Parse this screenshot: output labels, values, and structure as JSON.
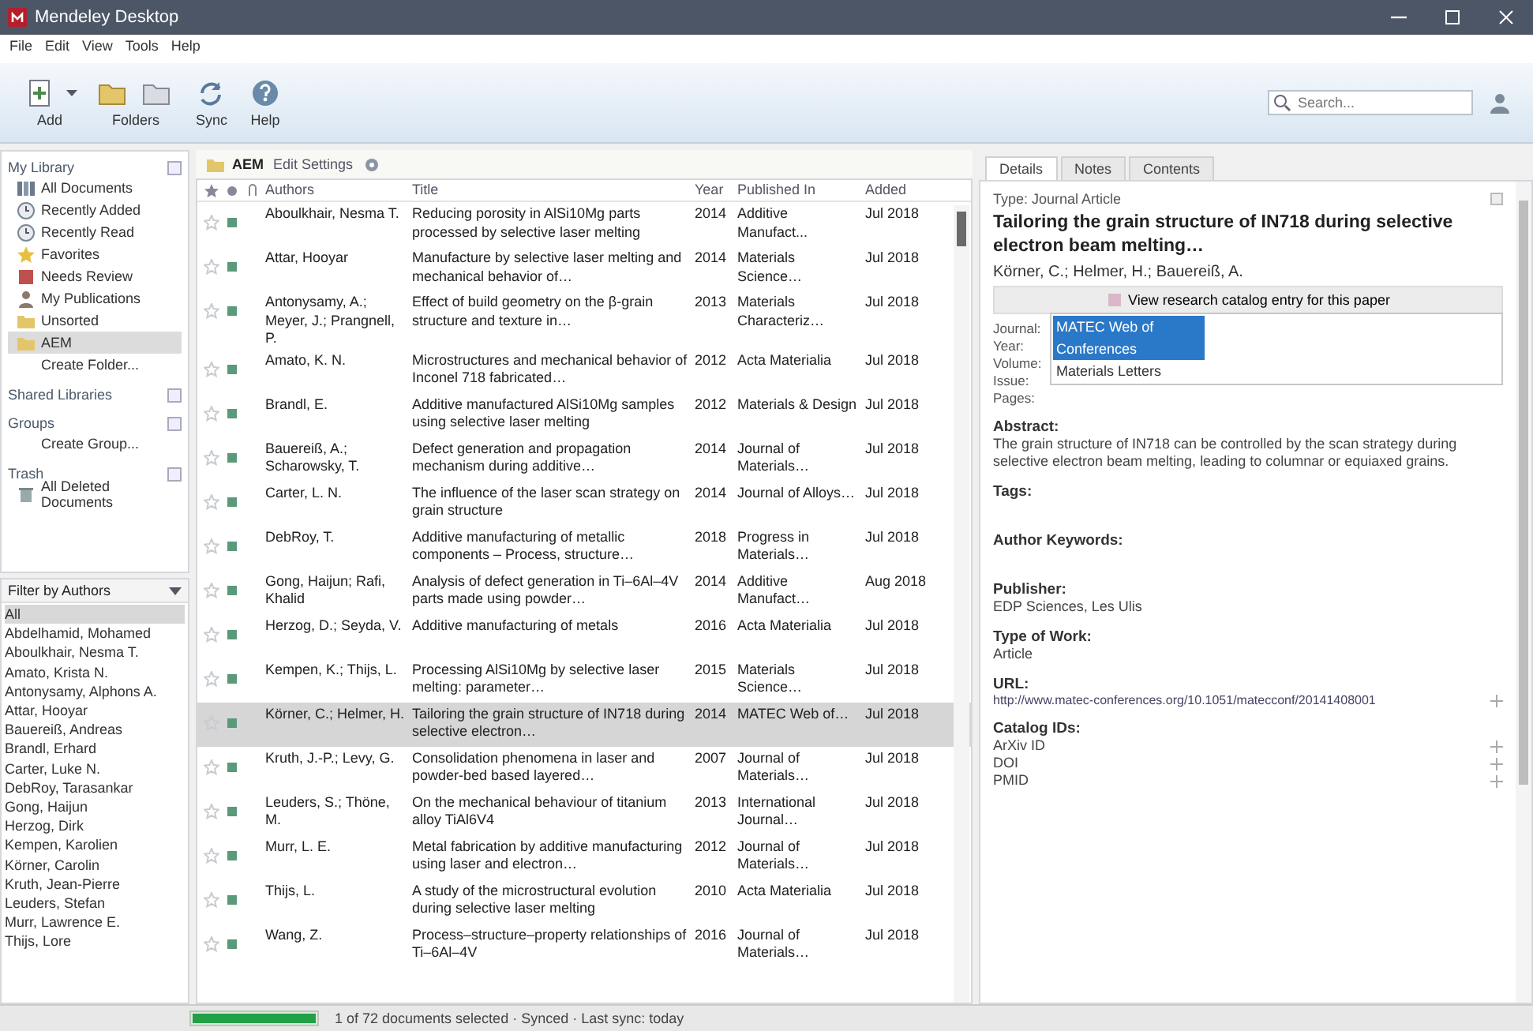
{
  "window": {
    "title": "Mendeley Desktop"
  },
  "menu": [
    "File",
    "Edit",
    "View",
    "Tools",
    "Help"
  ],
  "toolbar": [
    {
      "kind": "add",
      "label": "Add"
    },
    {
      "kind": "folders",
      "label": "Folders"
    },
    {
      "kind": "sync",
      "label": "Sync"
    },
    {
      "kind": "help",
      "label": "Help"
    }
  ],
  "search": {
    "placeholder": "Search..."
  },
  "sidebar": {
    "sections": [
      {
        "title": "My Library",
        "items": [
          {
            "kind": "library",
            "label": "All Documents",
            "selected": false
          },
          {
            "kind": "clock",
            "label": "Recently Added",
            "selected": false
          },
          {
            "kind": "clock",
            "label": "Recently Read",
            "selected": false
          },
          {
            "kind": "star",
            "label": "Favorites",
            "selected": false
          },
          {
            "kind": "flag",
            "label": "Needs Review",
            "selected": false
          },
          {
            "kind": "person",
            "label": "My Publications",
            "selected": false
          },
          {
            "kind": "folder",
            "label": "Unsorted",
            "selected": false
          },
          {
            "kind": "folder",
            "label": "AEM",
            "selected": true
          },
          {
            "kind": "plain",
            "label": "Create Folder...",
            "selected": false
          }
        ]
      },
      {
        "title": "Shared Libraries"
      },
      {
        "title": "Groups",
        "items": [
          {
            "kind": "plain",
            "label": "Create Group...",
            "selected": false
          }
        ]
      },
      {
        "title": "Trash",
        "items": [
          {
            "kind": "trash",
            "label": "All Deleted Documents",
            "selected": false
          }
        ]
      }
    ]
  },
  "filter": {
    "label": "Filter by Authors",
    "items": [
      {
        "label": "All",
        "selected": true
      },
      {
        "label": "Abdelhamid, Mohamed",
        "selected": false
      },
      {
        "label": "Aboulkhair, Nesma T.",
        "selected": false
      },
      {
        "label": "Amato, Krista N.",
        "selected": false
      },
      {
        "label": "Antonysamy, Alphons A.",
        "selected": false
      },
      {
        "label": "Attar, Hooyar",
        "selected": false
      },
      {
        "label": "Bauereiß, Andreas",
        "selected": false
      },
      {
        "label": "Brandl, Erhard",
        "selected": false
      },
      {
        "label": "Carter, Luke N.",
        "selected": false
      },
      {
        "label": "DebRoy, Tarasankar",
        "selected": false
      },
      {
        "label": "Gong, Haijun",
        "selected": false
      },
      {
        "label": "Herzog, Dirk",
        "selected": false
      },
      {
        "label": "Kempen, Karolien",
        "selected": false
      },
      {
        "label": "Körner, Carolin",
        "selected": false
      },
      {
        "label": "Kruth, Jean-Pierre",
        "selected": false
      },
      {
        "label": "Leuders, Stefan",
        "selected": false
      },
      {
        "label": "Murr, Lawrence E.",
        "selected": false
      },
      {
        "label": "Thijs, Lore",
        "selected": false
      }
    ]
  },
  "folder_bar": {
    "name": "AEM",
    "action": "Edit Settings"
  },
  "table": {
    "columns": [
      "Authors",
      "Title",
      "Year",
      "Published In",
      "Added"
    ],
    "rows": [
      {
        "unread": true,
        "selected": false,
        "cells": [
          "Aboulkhair, Nesma T.",
          "Reducing porosity in AlSi10Mg parts processed by selective laser melting",
          "2014",
          "Additive Manufact...",
          "Jul 2018"
        ]
      },
      {
        "unread": true,
        "selected": false,
        "cells": [
          "Attar, Hooyar",
          "Manufacture by selective laser melting and mechanical behavior of…",
          "2014",
          "Materials Science…",
          "Jul 2018"
        ]
      },
      {
        "unread": true,
        "selected": false,
        "cells": [
          "Antonysamy, A.; Meyer, J.; Prangnell, P.",
          "Effect of build geometry on the β-grain structure and texture in…",
          "2013",
          "Materials Characteriz…",
          "Jul 2018"
        ]
      },
      {
        "unread": true,
        "selected": false,
        "cells": [
          "Amato, K. N.",
          "Microstructures and mechanical behavior of Inconel 718 fabricated…",
          "2012",
          "Acta Materialia",
          "Jul 2018"
        ]
      },
      {
        "unread": true,
        "selected": false,
        "cells": [
          "Brandl, E.",
          "Additive manufactured AlSi10Mg samples using selective laser melting",
          "2012",
          "Materials & Design",
          "Jul 2018"
        ]
      },
      {
        "unread": true,
        "selected": false,
        "cells": [
          "Bauereiß, A.; Scharowsky, T.",
          "Defect generation and propagation mechanism during additive…",
          "2014",
          "Journal of Materials…",
          "Jul 2018"
        ]
      },
      {
        "unread": true,
        "selected": false,
        "cells": [
          "Carter, L. N.",
          "The influence of the laser scan strategy on grain structure",
          "2014",
          "Journal of Alloys…",
          "Jul 2018"
        ]
      },
      {
        "unread": true,
        "selected": false,
        "cells": [
          "DebRoy, T.",
          "Additive manufacturing of metallic components – Process, structure…",
          "2018",
          "Progress in Materials…",
          "Jul 2018"
        ]
      },
      {
        "unread": true,
        "selected": false,
        "cells": [
          "Gong, Haijun; Rafi, Khalid",
          "Analysis of defect generation in Ti–6Al–4V parts made using powder…",
          "2014",
          "Additive Manufact…",
          "Aug 2018"
        ]
      },
      {
        "unread": true,
        "selected": false,
        "cells": [
          "Herzog, D.; Seyda, V.",
          "Additive manufacturing of metals",
          "2016",
          "Acta Materialia",
          "Jul 2018"
        ]
      },
      {
        "unread": true,
        "selected": false,
        "cells": [
          "Kempen, K.; Thijs, L.",
          "Processing AlSi10Mg by selective laser melting: parameter…",
          "2015",
          "Materials Science…",
          "Jul 2018"
        ]
      },
      {
        "unread": true,
        "selected": true,
        "cells": [
          "Körner, C.; Helmer, H.",
          "Tailoring the grain structure of IN718 during selective electron…",
          "2014",
          "MATEC Web of…",
          "Jul 2018"
        ]
      },
      {
        "unread": true,
        "selected": false,
        "cells": [
          "Kruth, J.-P.; Levy, G.",
          "Consolidation phenomena in laser and powder-bed based layered…",
          "2007",
          "Journal of Materials…",
          "Jul 2018"
        ]
      },
      {
        "unread": true,
        "selected": false,
        "cells": [
          "Leuders, S.; Thöne, M.",
          "On the mechanical behaviour of titanium alloy TiAl6V4",
          "2013",
          "International Journal…",
          "Jul 2018"
        ]
      },
      {
        "unread": true,
        "selected": false,
        "cells": [
          "Murr, L. E.",
          "Metal fabrication by additive manufacturing using laser and electron…",
          "2012",
          "Journal of Materials…",
          "Jul 2018"
        ]
      },
      {
        "unread": true,
        "selected": false,
        "cells": [
          "Thijs, L.",
          "A study of the microstructural evolution during selective laser melting",
          "2010",
          "Acta Materialia",
          "Jul 2018"
        ]
      },
      {
        "unread": true,
        "selected": false,
        "cells": [
          "Wang, Z.",
          "Process–structure–property relationships of Ti–6Al–4V",
          "2016",
          "Journal of Materials…",
          "Jul 2018"
        ]
      }
    ]
  },
  "details": {
    "tabs": [
      {
        "label": "Details",
        "selected": true
      },
      {
        "label": "Notes",
        "selected": false
      },
      {
        "label": "Contents",
        "selected": false
      }
    ],
    "type": "Type: Journal Article",
    "title": "Tailoring the grain structure of IN718 during selective electron beam melting…",
    "authors": "Körner, C.; Helmer, H.; Bauereiß, A.",
    "catalog_button": "View research catalog entry for this paper",
    "fields": [
      {
        "label": "Journal:"
      },
      {
        "label": "Year:"
      },
      {
        "label": "Volume:"
      },
      {
        "label": "Issue:"
      },
      {
        "label": "Pages:"
      }
    ],
    "dropdown": [
      {
        "label": "MATEC Web of Conferences",
        "selected": true
      },
      {
        "label": "Materials Letters",
        "selected": false
      }
    ],
    "sections": [
      {
        "kind": "text",
        "heading": "Abstract:",
        "value": "The grain structure of IN718 can be controlled by the scan strategy during selective electron beam melting, leading to columnar or equiaxed grains."
      },
      {
        "kind": "text",
        "heading": "Tags:"
      },
      {
        "kind": "text",
        "heading": "Author Keywords:"
      },
      {
        "kind": "text",
        "heading": "Publisher:",
        "value": "EDP Sciences, Les Ulis"
      },
      {
        "kind": "text",
        "heading": "Type of Work:",
        "value": "Article"
      },
      {
        "kind": "link",
        "heading": "URL:",
        "value": "http://www.matec-conferences.org/10.1051/matecconf/20141408001"
      },
      {
        "kind": "ids",
        "heading": "Catalog IDs:",
        "value": "ArXiv ID",
        "extra": [
          "DOI",
          "PMID"
        ]
      }
    ]
  },
  "status": {
    "level": 1,
    "text": "1 of 72 documents selected · Synced · Last sync: today"
  }
}
